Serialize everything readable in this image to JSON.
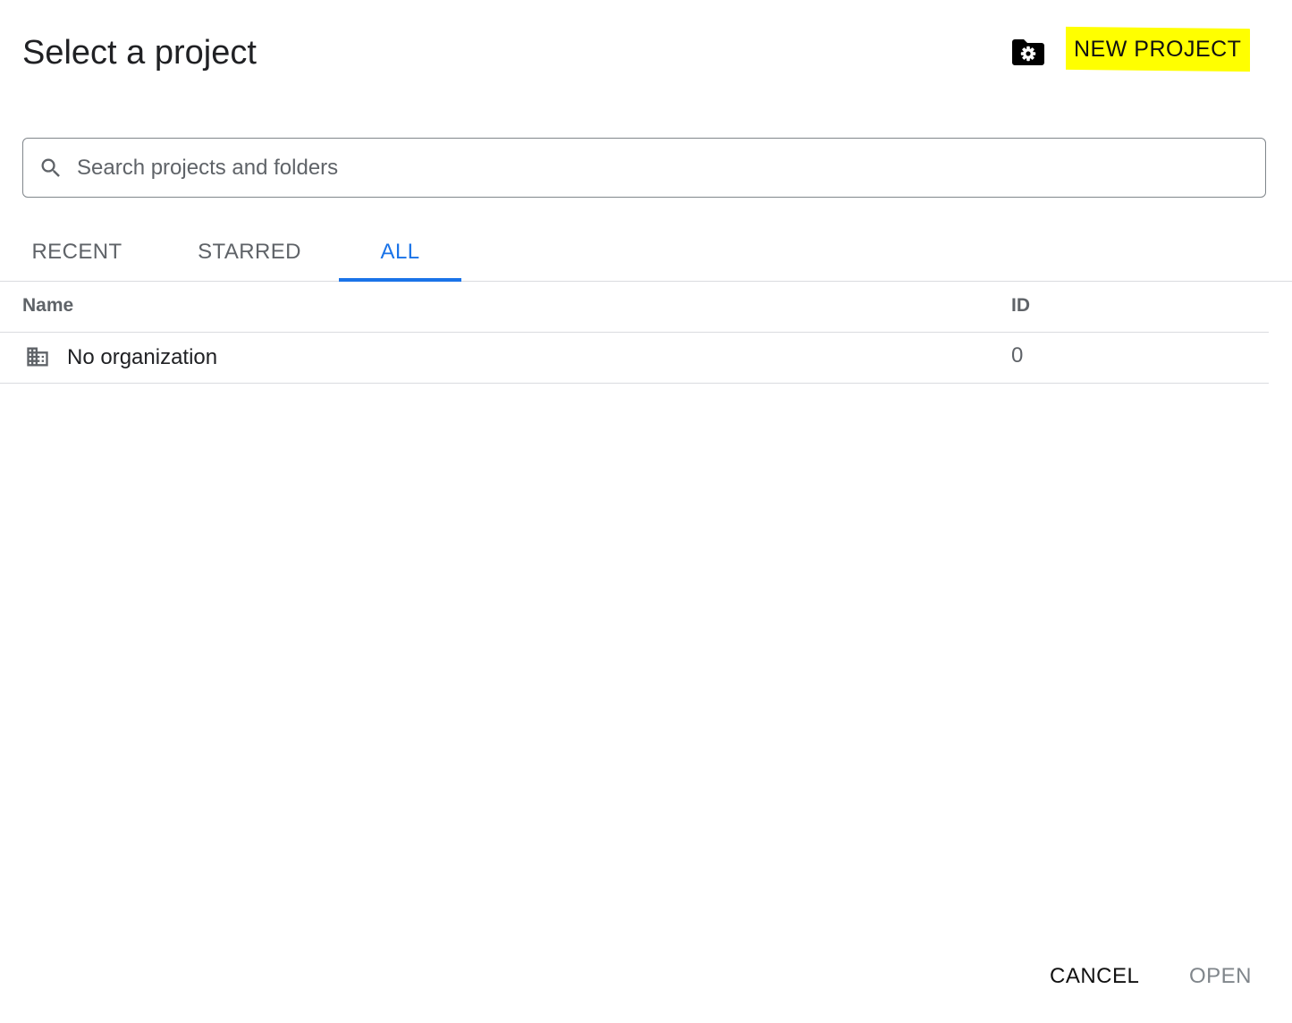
{
  "dialog": {
    "title": "Select a project",
    "new_project_label": "NEW PROJECT",
    "highlight_color": "#ffff00"
  },
  "search": {
    "placeholder": "Search projects and folders",
    "value": ""
  },
  "tabs": [
    {
      "label": "RECENT",
      "active": false
    },
    {
      "label": "STARRED",
      "active": false
    },
    {
      "label": "ALL",
      "active": true
    }
  ],
  "table": {
    "columns": [
      "Name",
      "ID"
    ],
    "rows": [
      {
        "name": "No organization",
        "id": "0",
        "icon": "organization-icon"
      }
    ]
  },
  "footer": {
    "cancel_label": "CANCEL",
    "open_label": "OPEN",
    "open_enabled": false
  },
  "colors": {
    "accent": "#1a73e8",
    "text": "#202124",
    "muted": "#5f6368",
    "divider": "#dadce0"
  }
}
